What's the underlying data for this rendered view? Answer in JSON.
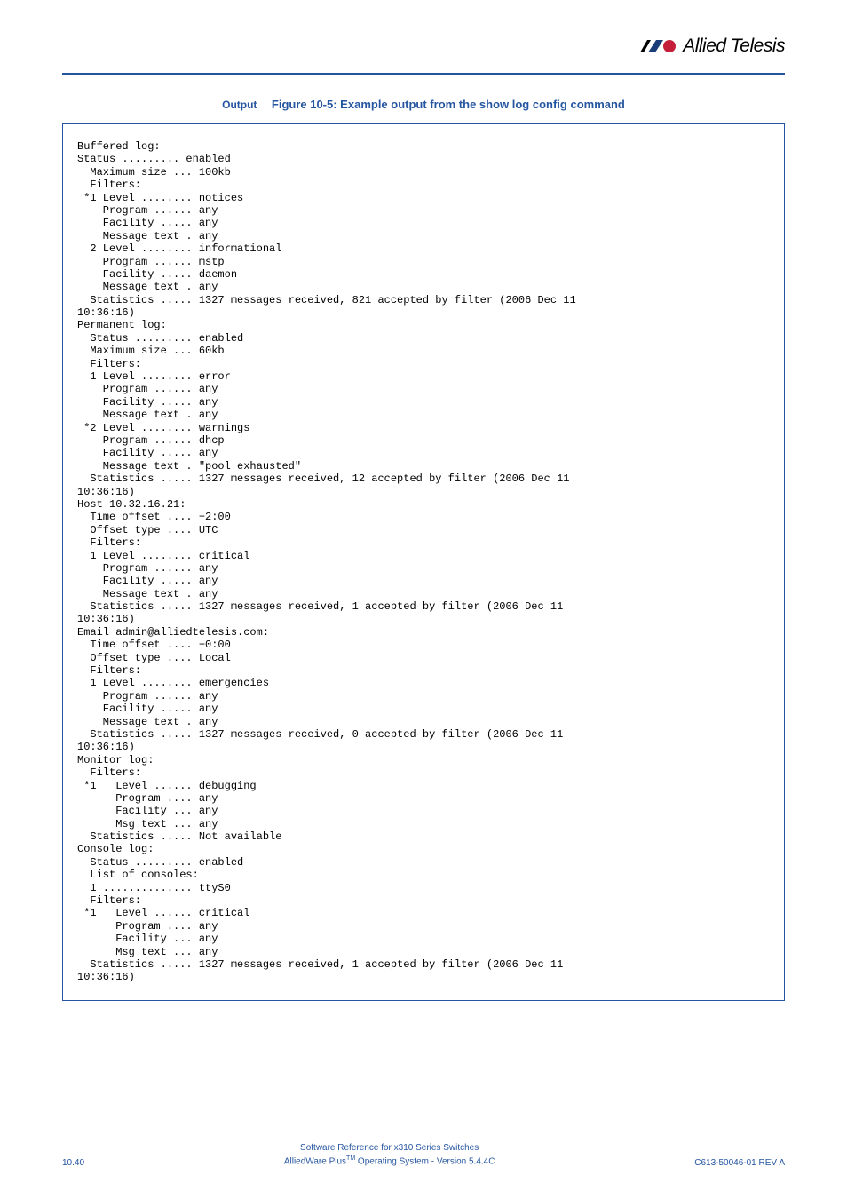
{
  "brand": {
    "name": "Allied Telesis"
  },
  "output": {
    "label": "Output",
    "figure_title": "Figure 10-5: Example output from the show log config command",
    "content": "Buffered log:\nStatus ......... enabled\n  Maximum size ... 100kb\n  Filters:\n *1 Level ........ notices\n    Program ...... any\n    Facility ..... any\n    Message text . any\n  2 Level ........ informational\n    Program ...... mstp\n    Facility ..... daemon\n    Message text . any\n  Statistics ..... 1327 messages received, 821 accepted by filter (2006 Dec 11 \n10:36:16)\nPermanent log:\n  Status ......... enabled\n  Maximum size ... 60kb\n  Filters:\n  1 Level ........ error\n    Program ...... any\n    Facility ..... any\n    Message text . any\n *2 Level ........ warnings\n    Program ...... dhcp\n    Facility ..... any\n    Message text . \"pool exhausted\"\n  Statistics ..... 1327 messages received, 12 accepted by filter (2006 Dec 11 \n10:36:16)\nHost 10.32.16.21:\n  Time offset .... +2:00\n  Offset type .... UTC\n  Filters:\n  1 Level ........ critical\n    Program ...... any\n    Facility ..... any\n    Message text . any\n  Statistics ..... 1327 messages received, 1 accepted by filter (2006 Dec 11 \n10:36:16)\nEmail admin@alliedtelesis.com:\n  Time offset .... +0:00\n  Offset type .... Local\n  Filters:\n  1 Level ........ emergencies\n    Program ...... any\n    Facility ..... any\n    Message text . any\n  Statistics ..... 1327 messages received, 0 accepted by filter (2006 Dec 11 \n10:36:16)\nMonitor log:\n  Filters:\n *1   Level ...... debugging\n      Program .... any\n      Facility ... any\n      Msg text ... any\n  Statistics ..... Not available\nConsole log:\n  Status ......... enabled\n  List of consoles:\n  1 .............. ttyS0\n  Filters:\n *1   Level ...... critical\n      Program .... any\n      Facility ... any\n      Msg text ... any\n  Statistics ..... 1327 messages received, 1 accepted by filter (2006 Dec 11 \n10:36:16)"
  },
  "footer": {
    "page_number": "10.40",
    "center_line1": "Software Reference for x310 Series Switches",
    "center_line2_prefix": "AlliedWare Plus",
    "center_line2_suffix": " Operating System  - Version 5.4.4C",
    "tm": "TM",
    "rev": "C613-50046-01 REV A"
  }
}
